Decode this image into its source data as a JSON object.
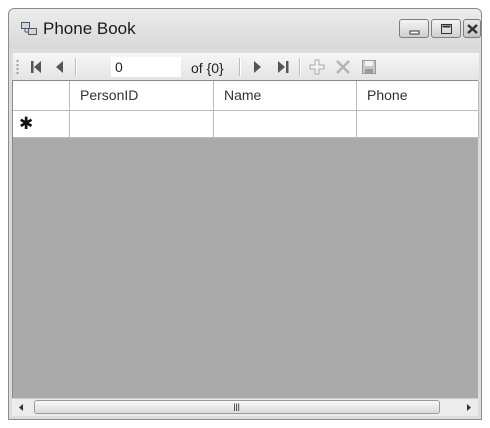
{
  "window": {
    "title": "Phone Book",
    "controls": [
      "minimize-icon",
      "maximize-icon",
      "close-icon"
    ]
  },
  "navigator": {
    "position_value": "0",
    "count_label": "of {0}",
    "buttons": [
      "move-first-icon",
      "move-previous-icon",
      "move-next-icon",
      "move-last-icon",
      "add-new-icon",
      "delete-icon",
      "save-icon"
    ]
  },
  "grid": {
    "columns": [
      "PersonID",
      "Name",
      "Phone"
    ],
    "new_row_marker": "✱"
  },
  "scrollbar": {
    "grip": "III"
  }
}
